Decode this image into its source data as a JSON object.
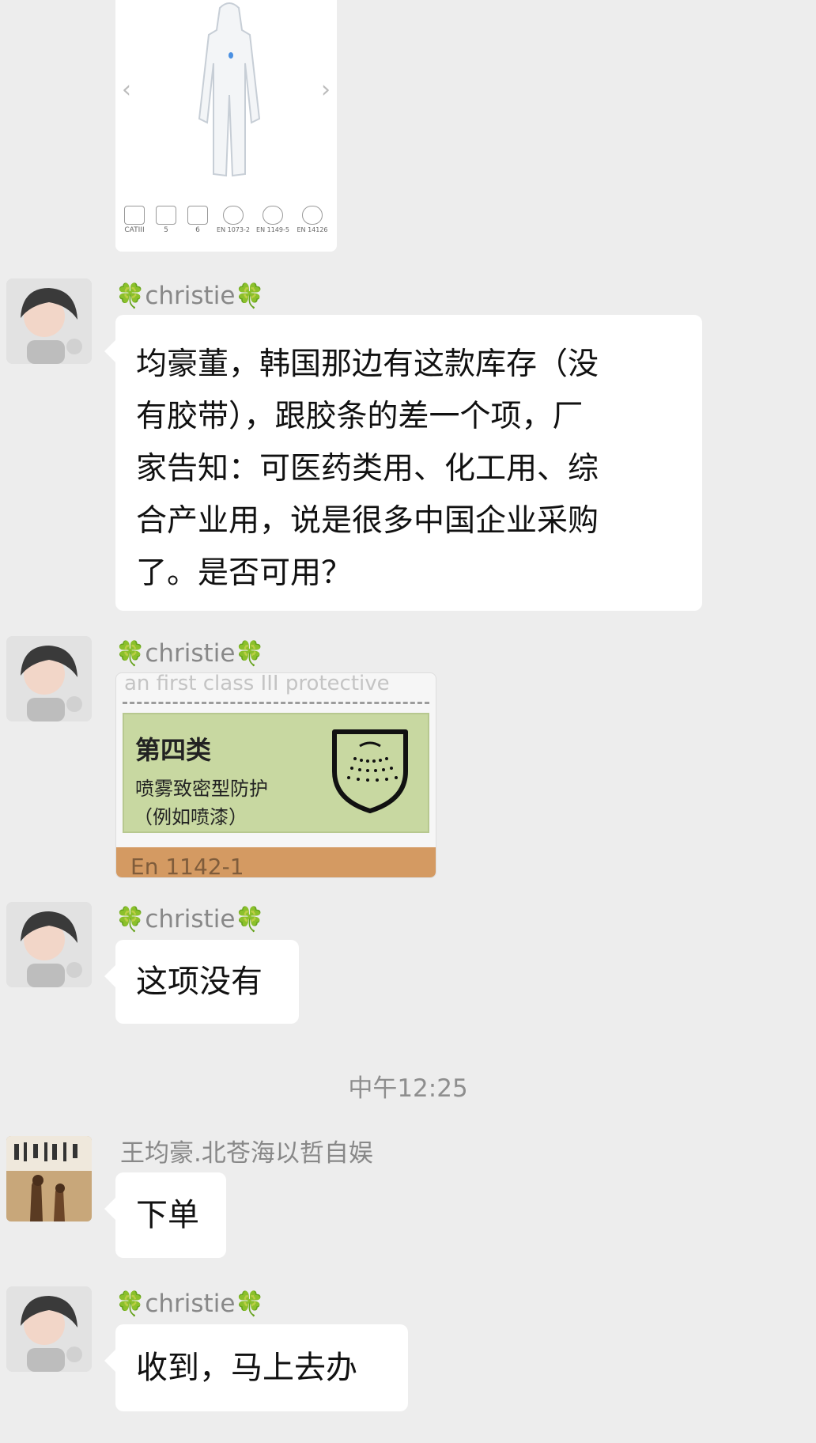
{
  "messages": [
    {
      "type": "image",
      "caption": "product",
      "badges": [
        "CATIII",
        "5",
        "6",
        "EN 1073-2",
        "EN 1149-5",
        "EN 14126"
      ]
    },
    {
      "type": "text",
      "sender": "christie",
      "text_lines": [
        "均豪董，韩国那边有这款库存（没",
        "有胶带），跟胶条的差一个项，厂",
        "家告知：可医药类用、化工用、综",
        "合产业用，说是很多中国企业采购",
        "了。是否可用？"
      ]
    },
    {
      "type": "image",
      "sender": "christie",
      "image_text": {
        "top_line": "an first class III protective",
        "category": "第四类",
        "desc": "喷雾致密型防护",
        "example": "（例如喷漆）",
        "bottom": "En 1142-1"
      }
    },
    {
      "type": "text",
      "sender": "christie",
      "text": "这项没有"
    },
    {
      "type": "timestamp",
      "text": "中午12:25"
    },
    {
      "type": "text",
      "sender": "王均豪.北苍海以哲自娱",
      "text": "下单"
    },
    {
      "type": "text",
      "sender": "christie",
      "text": "收到，马上去办"
    }
  ],
  "ui": {
    "clover_symbol": "🍀",
    "colors": {
      "background": "#ededed",
      "bubble": "#ffffff",
      "name": "#888888",
      "timestamp": "#8e8e8e"
    },
    "icons": [
      "chevron-left-icon",
      "chevron-right-icon",
      "spray-shield-icon",
      "clover-icon"
    ]
  }
}
